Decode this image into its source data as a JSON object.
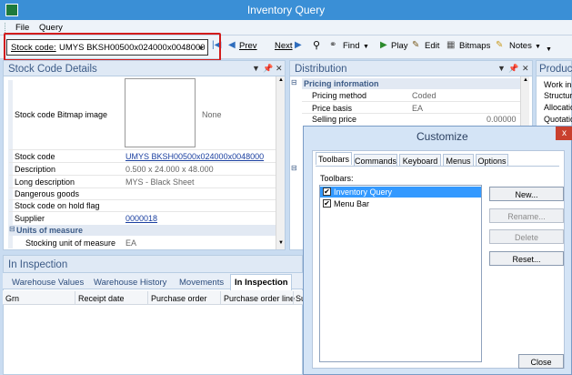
{
  "window": {
    "title": "Inventory Query"
  },
  "menu": [
    "File",
    "Query"
  ],
  "toolbar": {
    "stock_code_label": "Stock code:",
    "stock_code_value": "UMYS BKSH00500x024000x0048000",
    "prev": "Prev",
    "next": "Next",
    "find": "Find",
    "play": "Play",
    "edit": "Edit",
    "bitmaps": "Bitmaps",
    "notes": "Notes"
  },
  "stock_panel": {
    "title": "Stock Code Details",
    "bitmap_label": "Stock code Bitmap image",
    "bitmap_value": "None",
    "rows": [
      {
        "label": "Stock code",
        "value": "UMYS BKSH00500x024000x0048000"
      },
      {
        "label": "Description",
        "value": "0.500 x 24.000 x  48.000"
      },
      {
        "label": "Long description",
        "value": "MYS - Black Sheet"
      },
      {
        "label": "Dangerous goods",
        "value": ""
      },
      {
        "label": "Stock code on hold flag",
        "value": ""
      },
      {
        "label": "Supplier",
        "value": "0000018"
      }
    ],
    "section": "Units of measure",
    "uom_label": "Stocking unit of measure",
    "uom_value": "EA"
  },
  "distribution_panel": {
    "title": "Distribution",
    "section": "Pricing information",
    "rows": [
      {
        "label": "Pricing method",
        "value": "Coded"
      },
      {
        "label": "Price basis",
        "value": "EA"
      },
      {
        "label": "Selling price",
        "value": "0.00000"
      }
    ]
  },
  "product_panel": {
    "title": "Produc",
    "items": [
      "Work in",
      "Structur",
      "Allocatio",
      "Quotatio"
    ]
  },
  "inspection_panel": {
    "title": "In Inspection",
    "tabs": [
      "Warehouse Values",
      "Warehouse History",
      "Movements",
      "In Inspection"
    ],
    "columns": [
      "Grn",
      "Receipt date",
      "Purchase order",
      "Purchase order line",
      "Su"
    ]
  },
  "dialog": {
    "title": "Customize",
    "close": "x",
    "tabs": [
      "Toolbars",
      "Commands",
      "Keyboard",
      "Menus",
      "Options"
    ],
    "list_label": "Toolbars:",
    "toolbars": [
      {
        "name": "Inventory Query",
        "checked": true
      },
      {
        "name": "Menu Bar",
        "checked": true
      }
    ],
    "buttons": {
      "new": "New...",
      "rename": "Rename...",
      "delete": "Delete",
      "reset": "Reset...",
      "close": "Close"
    }
  },
  "colors": {
    "titlebar": "#3a8fd6",
    "highlight": "#d21c1c",
    "link": "#1a3fa0",
    "selection": "#3399ff"
  }
}
